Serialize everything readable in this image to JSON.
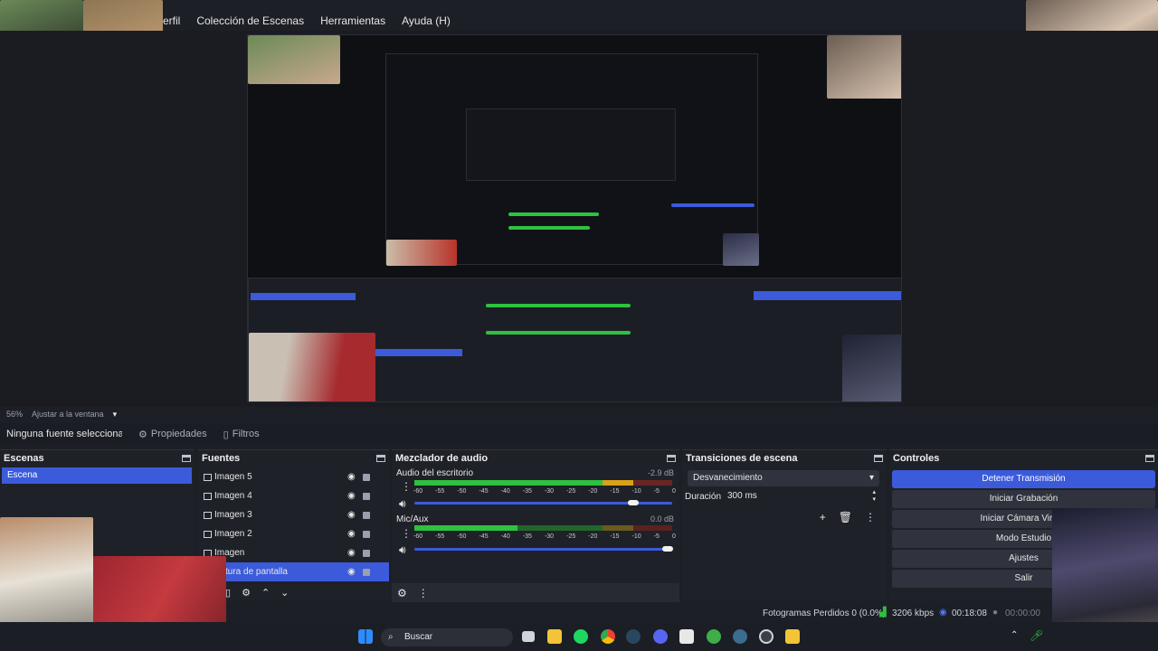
{
  "menu": [
    "erfil",
    "Colección de Escenas",
    "Herramientas",
    "Ayuda (H)"
  ],
  "toolbar": {
    "zoom": "56%",
    "fit": "Ajustar a la ventana",
    "no_source": "Ninguna fuente seleccionad",
    "properties": "Propiedades",
    "filters": "Filtros"
  },
  "scenes": {
    "title": "Escenas",
    "items": [
      "Escena"
    ]
  },
  "sources": {
    "title": "Fuentes",
    "items": [
      "Imagen 5",
      "Imagen 4",
      "Imagen 3",
      "Imagen 2",
      "Imagen",
      "tura de pantalla"
    ]
  },
  "mixer": {
    "title": "Mezclador de audio",
    "scale": [
      "-60",
      "-55",
      "-50",
      "-45",
      "-40",
      "-35",
      "-30",
      "-25",
      "-20",
      "-15",
      "-10",
      "-5",
      "0"
    ],
    "channels": [
      {
        "name": "Audio del escritorio",
        "db": "-2.9 dB",
        "level": 0.8,
        "volume": 0.82
      },
      {
        "name": "Mic/Aux",
        "db": "0.0 dB",
        "level": 0.4,
        "volume": 1.0
      }
    ]
  },
  "transitions": {
    "title": "Transiciones de escena",
    "selected": "Desvanecimiento",
    "duration_label": "Duración",
    "duration_value": "300 ms"
  },
  "controls": {
    "title": "Controles",
    "buttons": [
      "Detener Transmisión",
      "Iniciar Grabación",
      "Iniciar Cámara Virtual",
      "Modo Estudio",
      "Ajustes",
      "Salir"
    ]
  },
  "status": {
    "dropped": "Fotogramas Perdidos 0 (0.0%)",
    "kbps": "3206 kbps",
    "stream_time": "00:18:08",
    "rec_time": "00:00:00"
  },
  "taskbar": {
    "search": "Buscar"
  },
  "colors": {
    "accent": "#3b5bdb",
    "meter_green": "#2fc140",
    "meter_yellow": "#d9a11a",
    "meter_red": "#b8332b"
  }
}
